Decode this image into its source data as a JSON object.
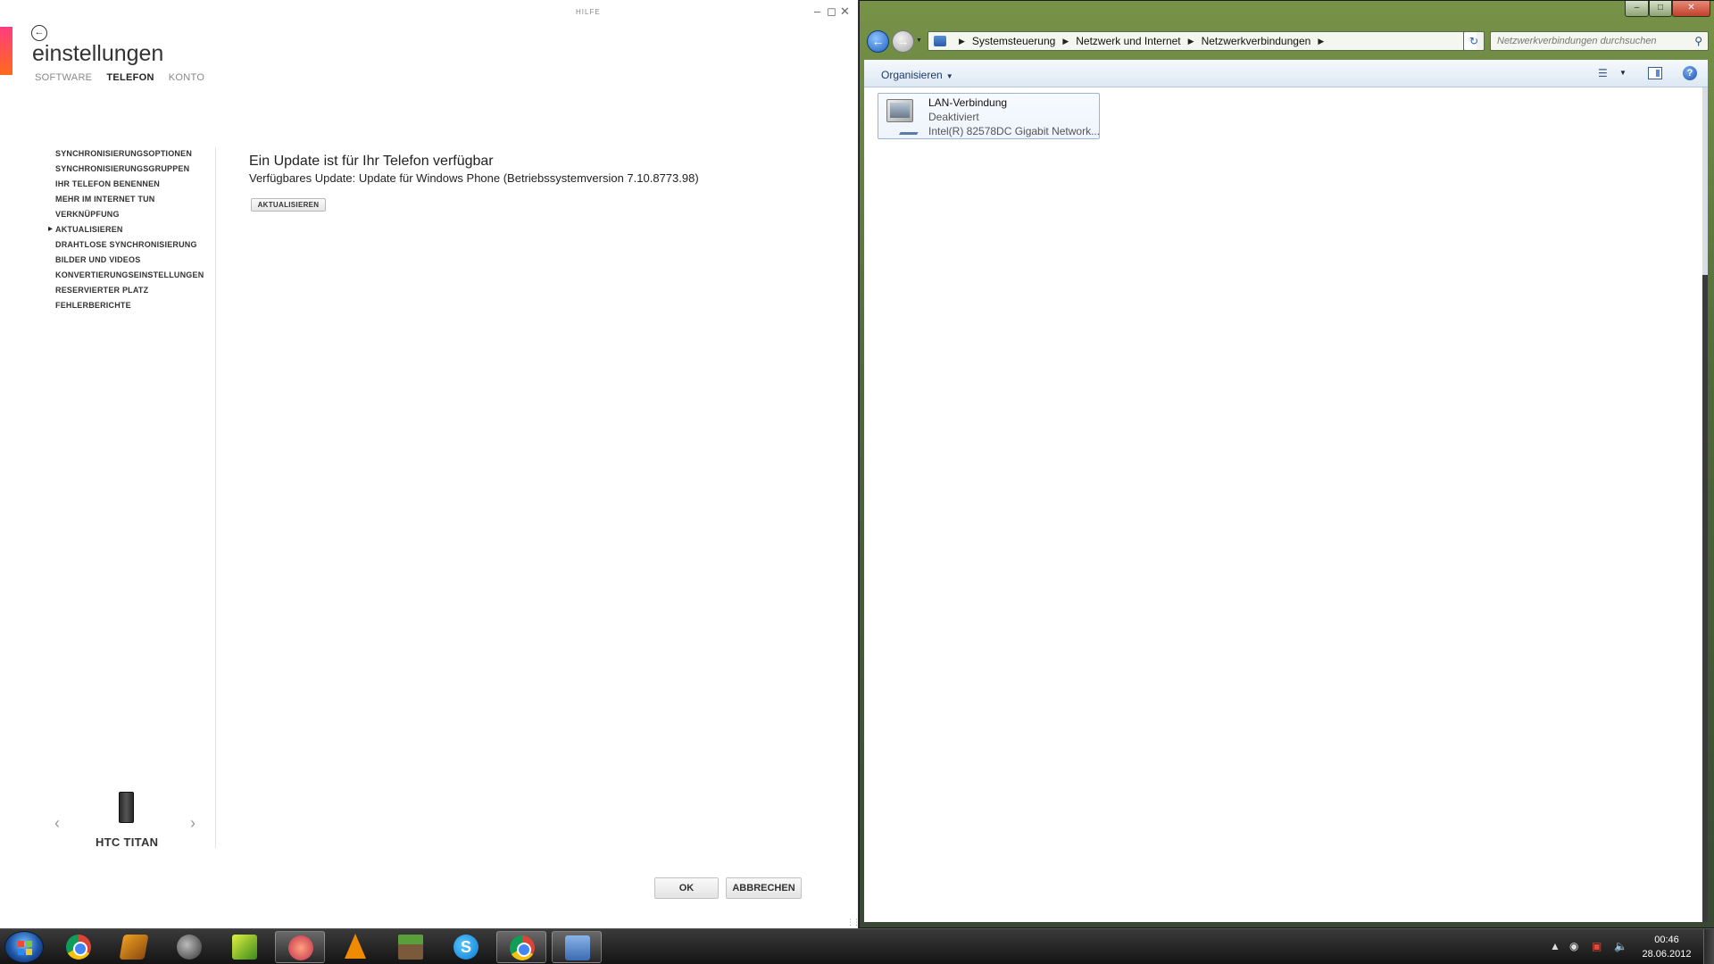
{
  "zune": {
    "help": "HILFE",
    "title": "einstellungen",
    "tabs": [
      {
        "label": "SOFTWARE"
      },
      {
        "label": "TELEFON"
      },
      {
        "label": "KONTO"
      }
    ],
    "menu": [
      {
        "label": "SYNCHRONISIERUNGSOPTIONEN"
      },
      {
        "label": "SYNCHRONISIERUNGSGRUPPEN"
      },
      {
        "label": "IHR TELEFON BENENNEN"
      },
      {
        "label": "MEHR IM INTERNET TUN"
      },
      {
        "label": "VERKNÜPFUNG"
      },
      {
        "label": "AKTUALISIEREN"
      },
      {
        "label": "DRAHTLOSE SYNCHRONISIERUNG"
      },
      {
        "label": "BILDER UND VIDEOS"
      },
      {
        "label": "KONVERTIERUNGSEINSTELLUNGEN"
      },
      {
        "label": "RESERVIERTER PLATZ"
      },
      {
        "label": "FEHLERBERICHTE"
      }
    ],
    "update_heading": "Ein Update ist für Ihr Telefon verfügbar",
    "update_detail": "Verfügbares Update: Update für Windows Phone (Betriebssystemversion 7.10.8773.98)",
    "update_button": "AKTUALISIEREN",
    "phone_name": "HTC TITAN",
    "ok_button": "OK",
    "cancel_button": "ABBRECHEN"
  },
  "explorer": {
    "breadcrumb": [
      "Systemsteuerung",
      "Netzwerk und Internet",
      "Netzwerkverbindungen"
    ],
    "search_placeholder": "Netzwerkverbindungen durchsuchen",
    "organize": "Organisieren",
    "connection": {
      "name": "LAN-Verbindung",
      "status": "Deaktiviert",
      "adapter": "Intel(R) 82578DC Gigabit Network..."
    }
  },
  "taskbar": {
    "time": "00:46",
    "date": "28.06.2012"
  }
}
